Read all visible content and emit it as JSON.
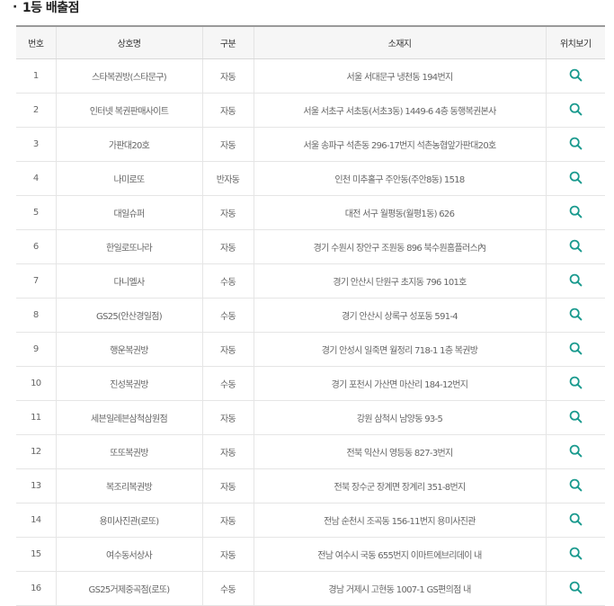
{
  "section_title": "1등 배출점",
  "title_bullet": "·",
  "columns": {
    "no": "번호",
    "name": "상호명",
    "type": "구분",
    "address": "소재지",
    "location": "위치보기"
  },
  "icon_color": "#1a9a8e",
  "rows": [
    {
      "no": "1",
      "name": "스타복권방(스타문구)",
      "type": "자동",
      "address": "서울 서대문구 냉천동 194번지"
    },
    {
      "no": "2",
      "name": "인터넷 복권판매사이트",
      "type": "자동",
      "address": "서울 서초구 서초동(서초3동) 1449-6 4층 동행복권본사"
    },
    {
      "no": "3",
      "name": "가판대20호",
      "type": "자동",
      "address": "서울 송파구 석촌동 296-17번지 석촌농협앞가판대20호"
    },
    {
      "no": "4",
      "name": "나미로또",
      "type": "반자동",
      "address": "인천 미추홀구 주안동(주안8동) 1518"
    },
    {
      "no": "5",
      "name": "대일슈퍼",
      "type": "자동",
      "address": "대전 서구 월평동(월평1동) 626"
    },
    {
      "no": "6",
      "name": "한일로또나라",
      "type": "자동",
      "address": "경기 수원시 장안구 조원동 896 북수원홈플러스內"
    },
    {
      "no": "7",
      "name": "다니엘사",
      "type": "수동",
      "address": "경기 안산시 단원구 초지동 796 101호"
    },
    {
      "no": "8",
      "name": "GS25(안산경일점)",
      "type": "수동",
      "address": "경기 안산시 상록구 성포동 591-4"
    },
    {
      "no": "9",
      "name": "행운복권방",
      "type": "자동",
      "address": "경기 안성시 일죽면 월정리 718-1 1층 복권방"
    },
    {
      "no": "10",
      "name": "진성복권방",
      "type": "수동",
      "address": "경기 포천시 가산면 마산리 184-12번지"
    },
    {
      "no": "11",
      "name": "세븐일레븐삼척삼원점",
      "type": "자동",
      "address": "강원 삼척시 남양동 93-5"
    },
    {
      "no": "12",
      "name": "또또복권방",
      "type": "자동",
      "address": "전북 익산시 영등동 827-3번지"
    },
    {
      "no": "13",
      "name": "복조리복권방",
      "type": "자동",
      "address": "전북 장수군 장계면 장계리 351-8번지"
    },
    {
      "no": "14",
      "name": "용미사진관(로또)",
      "type": "자동",
      "address": "전남 순천시 조곡동 156-11번지 용미사진관"
    },
    {
      "no": "15",
      "name": "여수동서상사",
      "type": "자동",
      "address": "전남 여수시 국동 655번지 이마트에브리데이 내"
    },
    {
      "no": "16",
      "name": "GS25거제중곡점(로또)",
      "type": "수동",
      "address": "경남 거제시 고현동 1007-1 GS편의점 내"
    }
  ]
}
